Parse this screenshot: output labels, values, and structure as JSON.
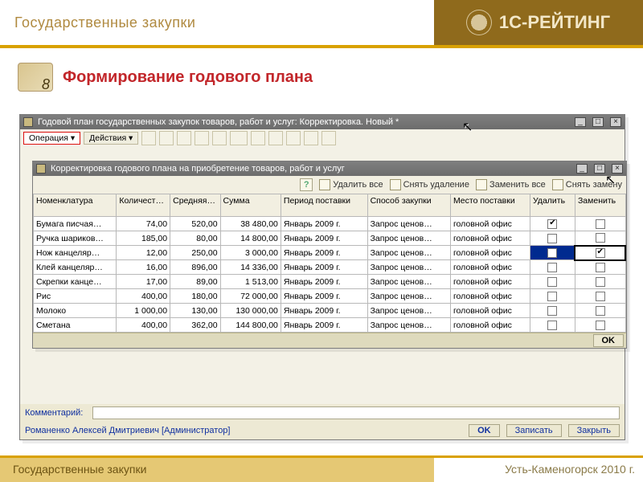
{
  "header": {
    "left_title": "Государственные закупки",
    "brand": "1С-РЕЙТИНГ"
  },
  "page": {
    "title": "Формирование годового плана"
  },
  "win1": {
    "title": "Годовой план государственных закупок товаров, работ и услуг: Корректировка. Новый *",
    "operation_btn": "Операция ▾",
    "actions_btn": "Действия ▾",
    "comment_label": "Комментарий:",
    "user_line": "Романенко Алексей Дмитриевич [Администратор]",
    "ok": "OK",
    "write": "Записать",
    "close": "Закрыть"
  },
  "win2": {
    "title": "Корректировка годового плана на приобретение товаров, работ и услуг",
    "toolbar": {
      "delete_all": "Удалить все",
      "undo_delete": "Снять удаление",
      "replace_all": "Заменить все",
      "undo_replace": "Снять замену"
    },
    "columns": [
      "Номенклатура",
      "Количест…",
      "Средняя цена",
      "Сумма",
      "Период поставки",
      "Способ закупки",
      "Место поставки",
      "Удалить",
      "Заменить"
    ],
    "rows": [
      {
        "name": "Бумага писчая…",
        "qty": "74,00",
        "price": "520,00",
        "sum": "38 480,00",
        "period": "Январь 2009 г.",
        "method": "Запрос ценов…",
        "place": "головной офис",
        "del": true,
        "rep": false
      },
      {
        "name": "Ручка шариков…",
        "qty": "185,00",
        "price": "80,00",
        "sum": "14 800,00",
        "period": "Январь 2009 г.",
        "method": "Запрос ценов…",
        "place": "головной офис",
        "del": false,
        "rep": false
      },
      {
        "name": "Нож канцеляр…",
        "qty": "12,00",
        "price": "250,00",
        "sum": "3 000,00",
        "period": "Январь 2009 г.",
        "method": "Запрос ценов…",
        "place": "головной офис",
        "del": false,
        "rep": true,
        "hl": true
      },
      {
        "name": "Клей канцеляр…",
        "qty": "16,00",
        "price": "896,00",
        "sum": "14 336,00",
        "period": "Январь 2009 г.",
        "method": "Запрос ценов…",
        "place": "головной офис",
        "del": false,
        "rep": false
      },
      {
        "name": "Скрепки канце…",
        "qty": "17,00",
        "price": "89,00",
        "sum": "1 513,00",
        "period": "Январь 2009 г.",
        "method": "Запрос ценов…",
        "place": "головной офис",
        "del": false,
        "rep": false
      },
      {
        "name": "Рис",
        "qty": "400,00",
        "price": "180,00",
        "sum": "72 000,00",
        "period": "Январь 2009 г.",
        "method": "Запрос ценов…",
        "place": "головной офис",
        "del": false,
        "rep": false
      },
      {
        "name": "Молоко",
        "qty": "1 000,00",
        "price": "130,00",
        "sum": "130 000,00",
        "period": "Январь 2009 г.",
        "method": "Запрос ценов…",
        "place": "головной офис",
        "del": false,
        "rep": false
      },
      {
        "name": "Сметана",
        "qty": "400,00",
        "price": "362,00",
        "sum": "144 800,00",
        "period": "Январь 2009 г.",
        "method": "Запрос ценов…",
        "place": "головной офис",
        "del": false,
        "rep": false
      }
    ],
    "ok": "OK"
  },
  "footer": {
    "left": "Государственные закупки",
    "right": "Усть-Каменогорск 2010 г."
  }
}
